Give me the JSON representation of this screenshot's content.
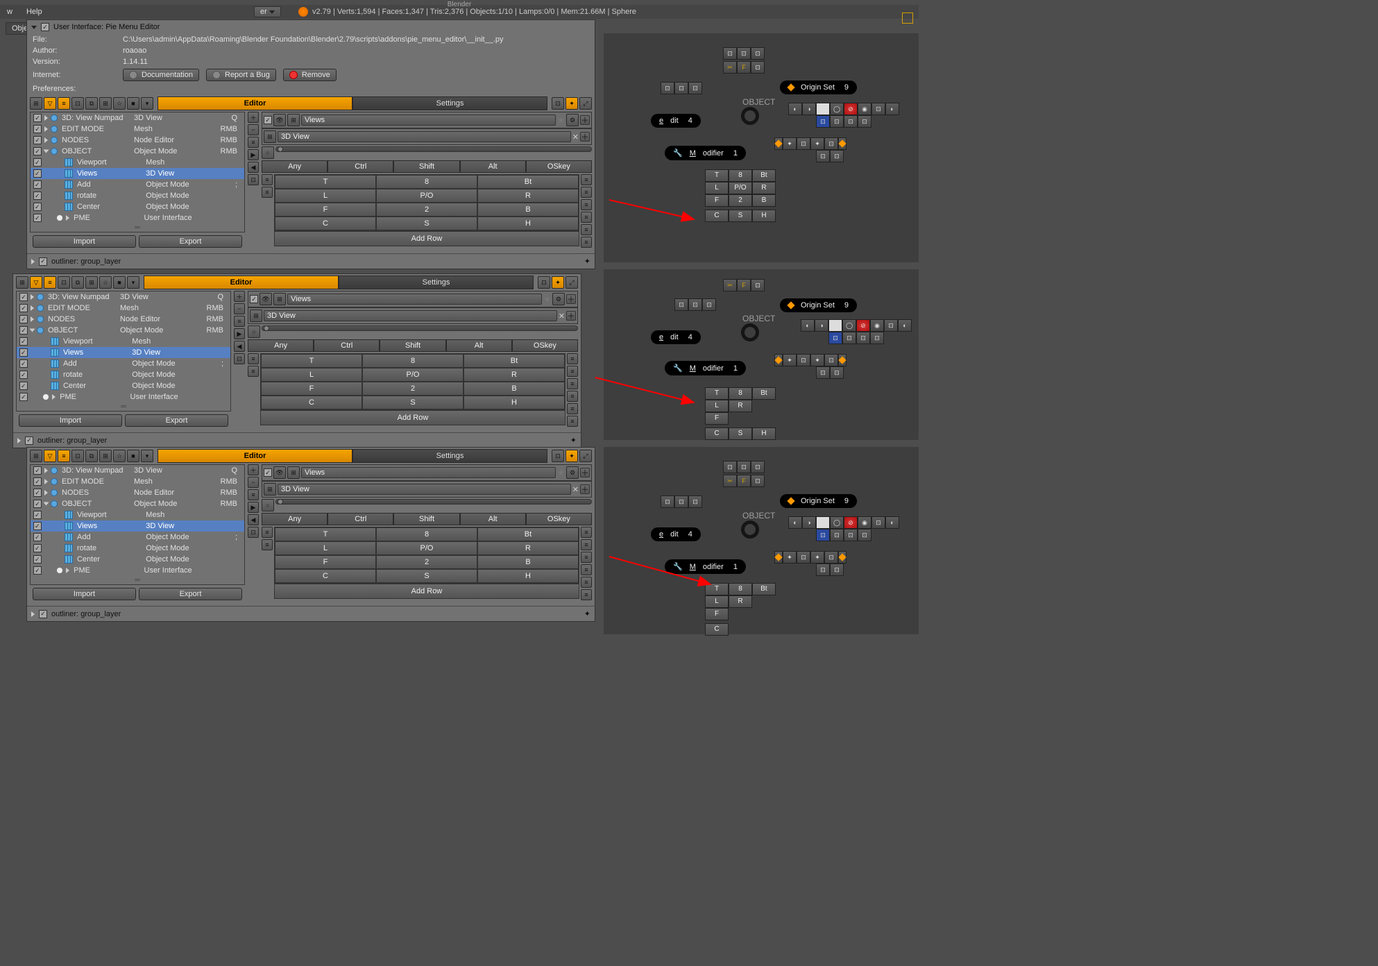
{
  "app": {
    "title": "Blender"
  },
  "topbar": {
    "menus": [
      "w",
      "Help"
    ],
    "er": "er",
    "stats": "v2.79 | Verts:1,594 | Faces:1,347 | Tris:2,376 | Objects:1/10 | Lamps:0/0 | Mem:21.66M | Sphere"
  },
  "addon": {
    "title": "User Interface: Pie Menu Editor",
    "file_label": "File:",
    "file_value": "C:\\Users\\admin\\AppData\\Roaming\\Blender Foundation\\Blender\\2.79\\scripts\\addons\\pie_menu_editor\\__init__.py",
    "author_label": "Author:",
    "author_value": "roaoao",
    "version_label": "Version:",
    "version_value": "1.14.11",
    "internet_label": "Internet:",
    "doc_btn": "Documentation",
    "bug_btn": "Report a Bug",
    "remove_btn": "Remove",
    "preferences": "Preferences:"
  },
  "tabs": {
    "editor": "Editor",
    "settings": "Settings"
  },
  "tree": {
    "items": [
      {
        "name": "3D: View Numpad",
        "type": "3D View",
        "key": "Q"
      },
      {
        "name": "EDIT MODE",
        "type": "Mesh",
        "key": "RMB"
      },
      {
        "name": "NODES",
        "type": "Node Editor",
        "key": "RMB"
      },
      {
        "name": "OBJECT",
        "type": "Object Mode",
        "key": "RMB"
      },
      {
        "name": "Viewport",
        "type": "Mesh",
        "key": ""
      },
      {
        "name": "Views",
        "type": "3D View",
        "key": ""
      },
      {
        "name": "Add",
        "type": "Object Mode",
        "key": ";"
      },
      {
        "name": "rotate",
        "type": "Object Mode",
        "key": ""
      },
      {
        "name": "Center",
        "type": "Object Mode",
        "key": ""
      },
      {
        "name": "PME",
        "type": "User Interface",
        "key": ""
      }
    ],
    "import": "Import",
    "export": "Export"
  },
  "outliner": {
    "label": "outliner: group_layer"
  },
  "right": {
    "views": "Views",
    "view3d": "3D View",
    "keys": [
      "Any",
      "Ctrl",
      "Shift",
      "Alt",
      "OSkey"
    ],
    "rows1": [
      [
        "T",
        "8",
        "Bt"
      ],
      [
        "L",
        "P/O",
        "R"
      ],
      [
        "F",
        "2",
        "B"
      ],
      [
        "C",
        "S",
        "H"
      ]
    ],
    "addrow": "Add Row"
  },
  "viewport": {
    "origin_set": "Origin Set",
    "origin_num": "9",
    "object": "OBJECT",
    "edit": "edit",
    "edit_num": "4",
    "modifier": "Modifier",
    "modifier_num": "1",
    "kg1": [
      [
        "T",
        "8",
        "Bt"
      ],
      [
        "L",
        "P/O",
        "R"
      ],
      [
        "F",
        "2",
        "B"
      ],
      [
        "C",
        "S",
        "H"
      ]
    ],
    "kg2": [
      [
        "T",
        "8",
        "Bt"
      ],
      [
        "L",
        "",
        "R"
      ],
      [
        "F",
        "",
        ""
      ],
      [
        "C",
        "S",
        "H"
      ]
    ],
    "kg3": [
      [
        "T",
        "8",
        "Bt"
      ],
      [
        "L",
        "",
        "R"
      ],
      [
        "F",
        "",
        ""
      ],
      [
        "C",
        "",
        ""
      ]
    ]
  }
}
